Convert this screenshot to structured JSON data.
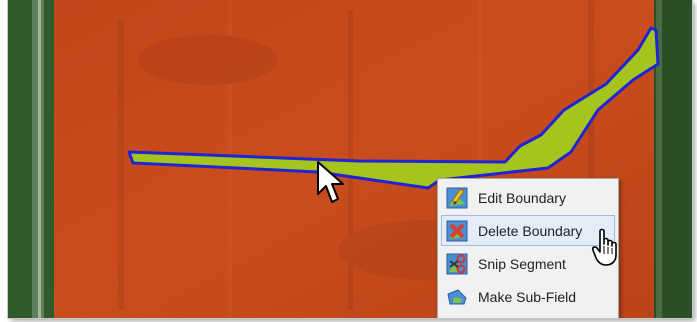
{
  "context_menu": {
    "items": [
      {
        "label": "Edit Boundary",
        "icon": "edit-boundary-icon",
        "hovered": false
      },
      {
        "label": "Delete Boundary",
        "icon": "delete-boundary-icon",
        "hovered": true
      },
      {
        "label": "Snip Segment",
        "icon": "snip-segment-icon",
        "hovered": false
      },
      {
        "label": "Make Sub-Field",
        "icon": "make-subfield-icon",
        "hovered": false
      }
    ]
  },
  "colors": {
    "field_fill": "#c44a1c",
    "boundary_fill": "#a6c41e",
    "boundary_stroke": "#1f24d6",
    "grass": "#2f5a2b",
    "menu_background": "#f1f1f1",
    "menu_hover": "#e4ecf7"
  }
}
